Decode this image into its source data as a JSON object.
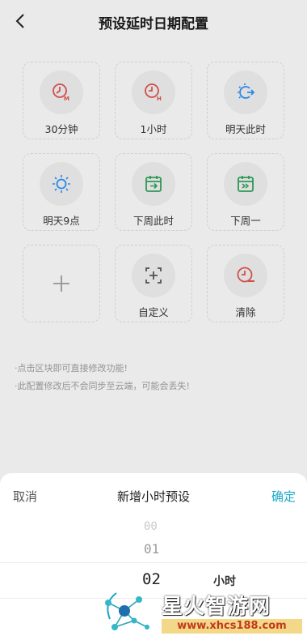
{
  "header": {
    "title": "预设延时日期配置"
  },
  "tiles": [
    {
      "label": "30分钟",
      "icon": "clock-m-icon"
    },
    {
      "label": "1小时",
      "icon": "clock-h-icon"
    },
    {
      "label": "明天此时",
      "icon": "sun-arrow-icon"
    },
    {
      "label": "明天9点",
      "icon": "sun-icon"
    },
    {
      "label": "下周此时",
      "icon": "calendar-arrow-icon"
    },
    {
      "label": "下周一",
      "icon": "calendar-skip-icon"
    },
    {
      "label": "",
      "icon": "plus-icon"
    },
    {
      "label": "自定义",
      "icon": "custom-icon"
    },
    {
      "label": "清除",
      "icon": "clock-minus-icon"
    }
  ],
  "hints": [
    "·点击区块即可直接修改功能!",
    "·此配置修改后不会同步至云端，可能会丢失!"
  ],
  "sheet": {
    "cancel": "取消",
    "title": "新增小时预设",
    "confirm": "确定",
    "picker": {
      "above2": "00",
      "above1": "01",
      "selected": "02",
      "unit": "小时"
    }
  },
  "watermark": {
    "title": "星火智游网",
    "url": "www.xhcs188.com"
  },
  "colors": {
    "red": "#d9534f",
    "blue": "#2e8ef0",
    "green": "#2f9e5a",
    "accent": "#1aa8c9"
  }
}
